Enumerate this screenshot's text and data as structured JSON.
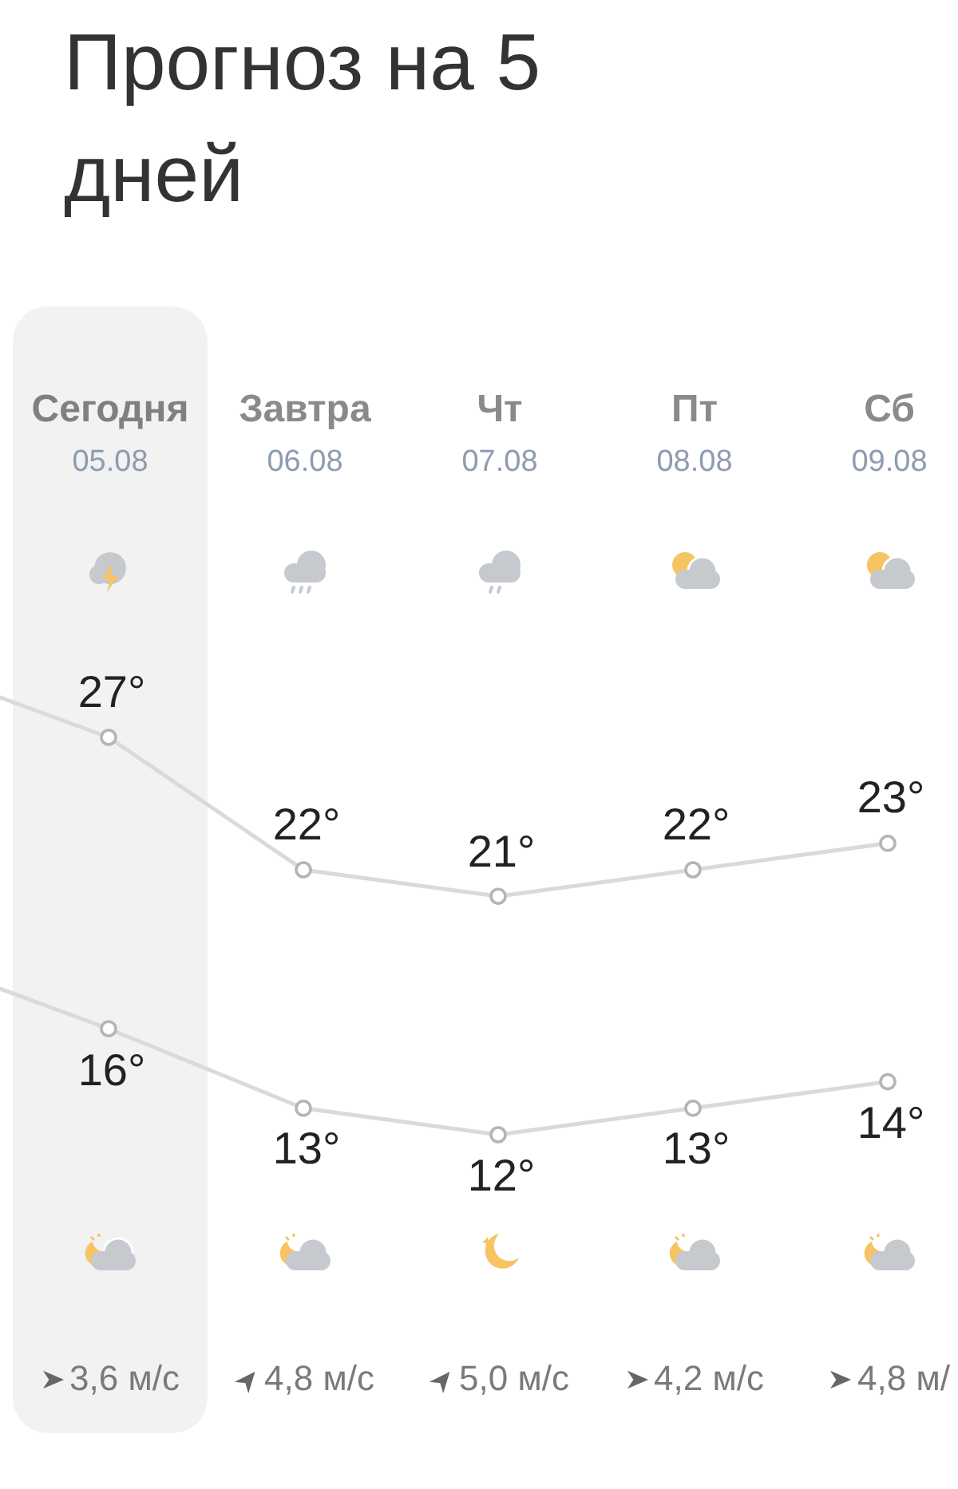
{
  "title": "Прогноз на 5 дней",
  "days": [
    {
      "label": "Сегодня",
      "date": "05.08",
      "selected": true,
      "day_weather": {
        "kind": "thunderstorm"
      },
      "night_weather": {
        "kind": "partly-cloudy-night"
      },
      "wind_arrow": {
        "kind": "east"
      },
      "wind": "3,6 м/с"
    },
    {
      "label": "Завтра",
      "date": "06.08",
      "selected": false,
      "day_weather": {
        "kind": "rain"
      },
      "night_weather": {
        "kind": "partly-cloudy-night"
      },
      "wind_arrow": {
        "kind": "northeast"
      },
      "wind": "4,8 м/с"
    },
    {
      "label": "Чт",
      "date": "07.08",
      "selected": false,
      "day_weather": {
        "kind": "drizzle"
      },
      "night_weather": {
        "kind": "moon"
      },
      "wind_arrow": {
        "kind": "northeast"
      },
      "wind": "5,0 м/с"
    },
    {
      "label": "Пт",
      "date": "08.08",
      "selected": false,
      "day_weather": {
        "kind": "cloudy"
      },
      "night_weather": {
        "kind": "partly-cloudy-night"
      },
      "wind_arrow": {
        "kind": "east"
      },
      "wind": "4,2 м/с"
    },
    {
      "label": "Сб",
      "date": "09.08",
      "selected": false,
      "day_weather": {
        "kind": "cloudy"
      },
      "night_weather": {
        "kind": "partly-cloudy-night"
      },
      "wind_arrow": {
        "kind": "east"
      },
      "wind": "4,8 м/"
    }
  ],
  "chart_data": {
    "type": "line",
    "data_labels": true,
    "categories": [
      null,
      null,
      null,
      null,
      null
    ],
    "series": [
      {
        "color": "#dadada",
        "marker": "circle",
        "values": [
          27,
          22,
          21,
          22,
          23
        ],
        "value_labels": [
          "27°",
          "22°",
          "21°",
          "22°",
          "23°"
        ]
      },
      {
        "color": "#dadada",
        "marker": "circle",
        "values": [
          16,
          13,
          12,
          13,
          14
        ],
        "value_labels": [
          "16°",
          "13°",
          "12°",
          "13°",
          "14°"
        ]
      }
    ]
  }
}
